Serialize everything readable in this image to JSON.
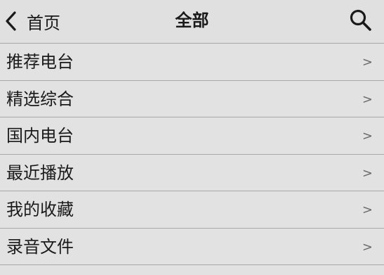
{
  "nav": {
    "back_label": "首页",
    "title": "全部"
  },
  "list": {
    "items": [
      {
        "label": "推荐电台",
        "arrow": ">"
      },
      {
        "label": "精选综合",
        "arrow": ">"
      },
      {
        "label": "国内电台",
        "arrow": ">"
      },
      {
        "label": "最近播放",
        "arrow": ">"
      },
      {
        "label": "我的收藏",
        "arrow": ">"
      },
      {
        "label": "录音文件",
        "arrow": ">"
      }
    ]
  },
  "icons": {
    "back": "chevron-left-icon",
    "search": "search-icon"
  },
  "colors": {
    "background": "#e2e2e2",
    "divider": "#a9a9a9",
    "text": "#1a1a1a",
    "arrow": "#6b6b6b"
  }
}
